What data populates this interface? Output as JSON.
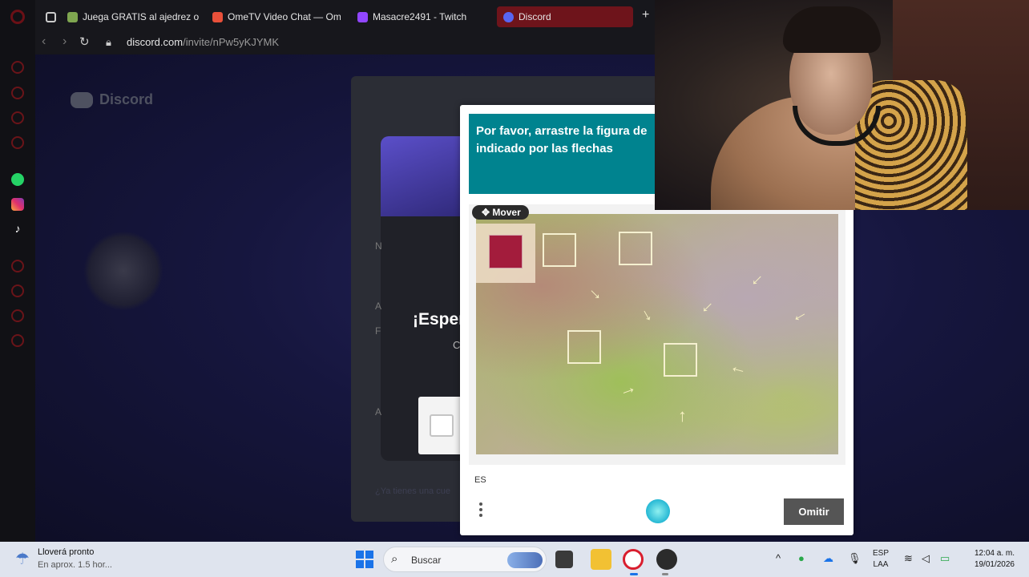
{
  "browser": {
    "tabs": [
      {
        "label": "Juega GRATIS al ajedrez o",
        "icon": "pawn-icon",
        "color": "#7fa650"
      },
      {
        "label": "OmeTV Video Chat — Om",
        "icon": "ometv-icon",
        "color": "#e8503a"
      },
      {
        "label": "Masacre2491 - Twitch",
        "icon": "twitch-icon",
        "color": "#9146ff"
      },
      {
        "label": "Discord",
        "icon": "discord-icon",
        "color": "#5865f2",
        "active": true
      }
    ],
    "new_tab": "+",
    "url_host": "discord.com",
    "url_path": "/invite/nPw5yKJYMK"
  },
  "discord": {
    "logo_text": "Discord",
    "wait_title": "¡Esper",
    "sub_text": "C",
    "frag_n": "N",
    "frag_a": "A",
    "frag_f": "F",
    "frag_a2": "A",
    "bottom_text": "¿Ya tienes una cue"
  },
  "captcha": {
    "prompt": "Por favor, arrastre la figura de indicado por las flechas",
    "move_label": "Mover",
    "language": "ES",
    "skip_label": "Omitir",
    "accent": "#00838f"
  },
  "taskbar": {
    "weather_title": "Lloverá pronto",
    "weather_sub": "En aprox. 1.5 hor...",
    "search_placeholder": "Buscar",
    "lang_top": "ESP",
    "lang_bottom": "LAA",
    "time": "12:04 a. m.",
    "date": "19/01/2026"
  }
}
